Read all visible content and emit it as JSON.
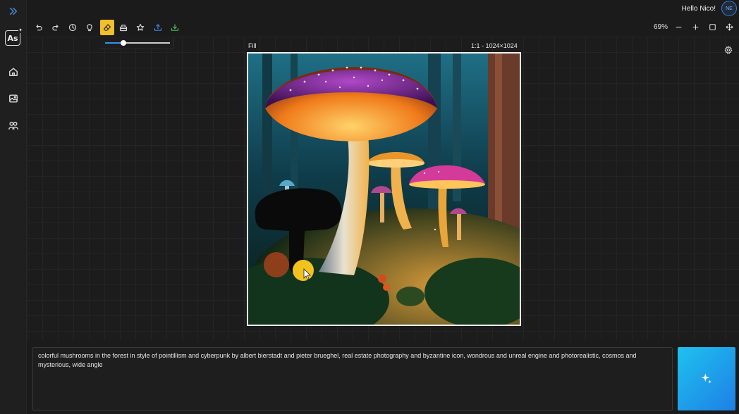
{
  "app": {
    "greeting": "Hello Nico!",
    "avatar_initials": "NE",
    "logo_text": "As"
  },
  "sidebar": {
    "items": [
      {
        "icon": "expand-chevrons-icon"
      },
      {
        "icon": "home-icon"
      },
      {
        "icon": "gallery-icon"
      },
      {
        "icon": "community-icon"
      }
    ]
  },
  "toolbar": {
    "tools": [
      {
        "icon": "undo-icon"
      },
      {
        "icon": "redo-icon"
      },
      {
        "icon": "history-icon"
      },
      {
        "icon": "lightbulb-icon"
      },
      {
        "icon": "eraser-icon",
        "active": true
      },
      {
        "icon": "basket-icon"
      },
      {
        "icon": "star-icon"
      },
      {
        "icon": "upload-icon"
      },
      {
        "icon": "download-icon"
      }
    ],
    "brush_size_fraction": 0.28,
    "zoom_label": "69%",
    "accent": "#f1bf2a",
    "slider_color": "#3a8ee8"
  },
  "canvas": {
    "mode_label": "Fill",
    "size_label": "1:1 - 1024×1024"
  },
  "prompt": {
    "text": "colorful mushrooms in the forest in style of pointillism and cyberpunk by albert bierstadt and pieter brueghel, real estate photography and byzantine icon, wondrous and unreal engine and photorealistic, cosmos and mysterious, wide angle"
  },
  "generate": {
    "icon": "sparkle-icon",
    "gradient": [
      "#1ec2ee",
      "#1e7fe6"
    ]
  }
}
